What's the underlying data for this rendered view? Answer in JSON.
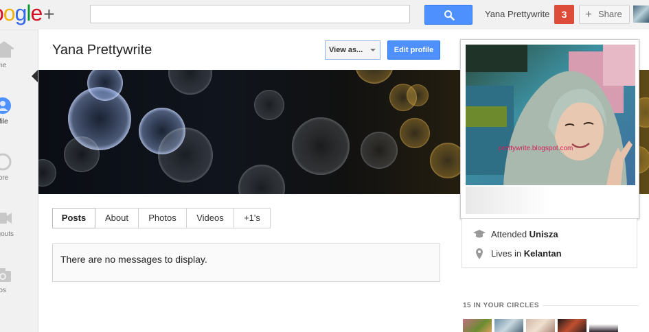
{
  "header": {
    "logo_letters": [
      "o",
      "o",
      "g",
      "l",
      "e"
    ],
    "logo_plus": "+",
    "search": {
      "value": "",
      "placeholder": ""
    },
    "search_icon": "magnifier-icon",
    "user_name": "Yana Prettywrite",
    "notification_count": "3",
    "share_label": "Share",
    "accent_color": "#4d90fe",
    "notification_color": "#dd4b39"
  },
  "sidebar": {
    "items": [
      {
        "label": "ome",
        "icon": "home-icon"
      },
      {
        "label": "rofile",
        "icon": "profile-icon"
      },
      {
        "label": "olore",
        "icon": "compass-icon"
      },
      {
        "label": "ngouts",
        "icon": "hangouts-icon"
      },
      {
        "label": "otos",
        "icon": "camera-icon"
      }
    ]
  },
  "profile": {
    "name": "Yana Prettywrite",
    "view_as_label": "View as...",
    "edit_label": "Edit profile",
    "photo_watermark": "prettywrite.blogspot.com"
  },
  "tabs": [
    {
      "label": "Posts"
    },
    {
      "label": "About"
    },
    {
      "label": "Photos"
    },
    {
      "label": "Videos"
    },
    {
      "label": "+1's"
    }
  ],
  "stream": {
    "empty_message": "There are no messages to display."
  },
  "info": {
    "education_prefix": "Attended",
    "education_value": "Unisza",
    "location_prefix": "Lives in",
    "location_value": "Kelantan"
  },
  "circles": {
    "label": "15 IN YOUR CIRCLES"
  }
}
